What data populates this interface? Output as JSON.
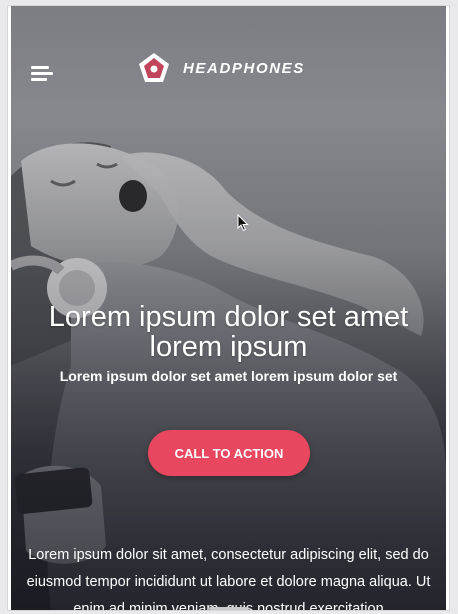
{
  "header": {
    "brand_name": "HEADPHONES",
    "menu_icon": "hamburger-menu-icon",
    "logo_icon": "pentagon-logo-icon"
  },
  "hero": {
    "headline": "Lorem ipsum dolor set amet lorem ipsum",
    "subheadline": "Lorem ipsum dolor set amet lorem ipsum dolor set",
    "cta_label": "CALL TO ACTION",
    "body_text": "Lorem ipsum dolor sit amet, consectetur adipiscing elit, sed do eiusmod tempor incididunt ut labore et dolore magna aliqua. Ut enim ad minim veniam, quis nostrud exercitation"
  },
  "colors": {
    "accent": "#e8475f",
    "text": "#ffffff",
    "logo_fill": "#c0455a"
  }
}
